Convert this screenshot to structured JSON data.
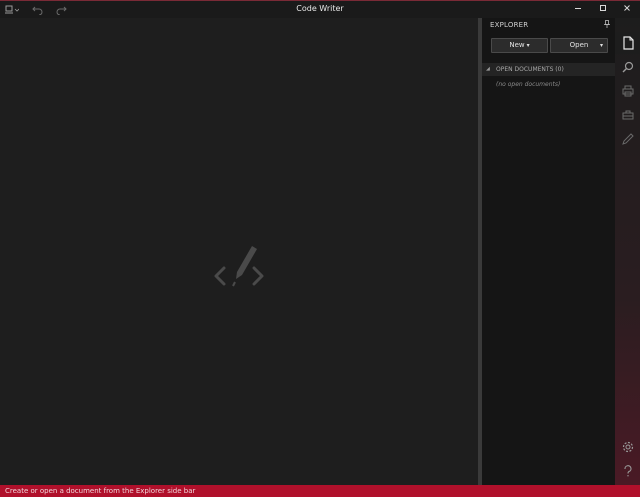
{
  "app": {
    "title": "Code Writer"
  },
  "titlebar": {
    "icons": [
      "app-menu-icon",
      "undo-icon",
      "redo-icon"
    ],
    "window_buttons": [
      "minimize-icon",
      "maximize-icon",
      "close-icon"
    ]
  },
  "editor": {
    "placeholder_icon": "code-pen-icon"
  },
  "explorer": {
    "title": "EXPLORER",
    "pin_icon": "pin-icon",
    "new_label": "New",
    "open_label": "Open",
    "open_documents_label": "OPEN DOCUMENTS (0)",
    "no_open_documents": "(no open documents)"
  },
  "rail": {
    "icons": [
      "document-icon",
      "search-icon",
      "print-icon",
      "share-icon",
      "pen-icon",
      "settings-icon",
      "help-icon"
    ]
  },
  "status": {
    "message": "Create or open a document from the Explorer side bar"
  },
  "colors": {
    "accent": "#b0102b",
    "background": "#1e1e1e",
    "sidebar": "#151515"
  }
}
